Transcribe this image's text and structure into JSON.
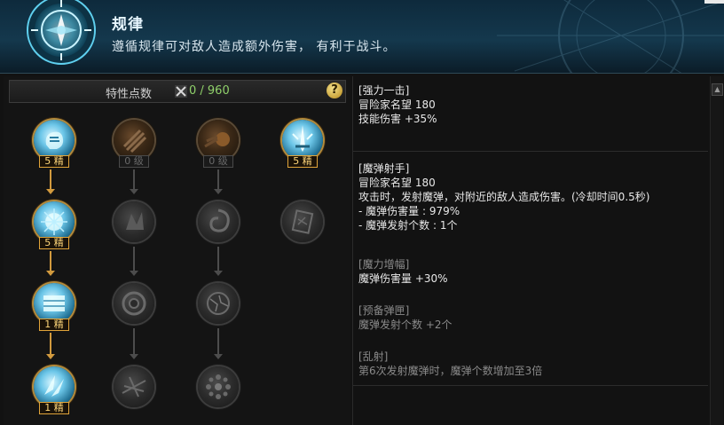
{
  "header": {
    "title": "规律",
    "description": "遵循规律可对敌人造成额外伤害， 有利于战斗。",
    "emblem_icon": "compass-emblem-icon"
  },
  "points": {
    "label": "特性点数",
    "value": "0 / 960",
    "icon": "crossed-swords-icon",
    "help_glyph": "?"
  },
  "skills": [
    {
      "id": "s1",
      "level": "5 精",
      "state": "active",
      "icon": "ice-fist-icon"
    },
    {
      "id": "s2",
      "level": "0 级",
      "state": "dormant",
      "icon": "dark-claw-icon"
    },
    {
      "id": "s3",
      "level": "0 级",
      "state": "dormant",
      "icon": "fire-comet-icon"
    },
    {
      "id": "s4",
      "level": "5 精",
      "state": "active",
      "icon": "ice-sword-icon"
    },
    {
      "id": "s5",
      "level": "5 精",
      "state": "active",
      "icon": "frost-burst-icon"
    },
    {
      "id": "s6",
      "level": "",
      "state": "locked",
      "icon": "shadow-beast-icon"
    },
    {
      "id": "s7",
      "level": "",
      "state": "locked",
      "icon": "vortex-icon"
    },
    {
      "id": "s8",
      "level": "",
      "state": "locked",
      "icon": "rune-tablet-icon"
    },
    {
      "id": "s9",
      "level": "1 精",
      "state": "active",
      "icon": "ice-block-icon"
    },
    {
      "id": "s10",
      "level": "",
      "state": "locked",
      "icon": "whirlwind-icon"
    },
    {
      "id": "s11",
      "level": "",
      "state": "locked",
      "icon": "cracked-orb-icon"
    },
    {
      "id": "s12",
      "level": "1 精",
      "state": "active",
      "icon": "ice-shards-icon"
    },
    {
      "id": "s13",
      "level": "",
      "state": "locked",
      "icon": "blade-slash-icon"
    },
    {
      "id": "s14",
      "level": "",
      "state": "locked",
      "icon": "orb-ring-icon"
    }
  ],
  "details": {
    "strong_strike": {
      "name": "[强力一击]",
      "fame_label": "冒险家名望",
      "fame_value": "180",
      "effect_label": "技能伤害",
      "effect_value": "+35%"
    },
    "magic_shooter": {
      "name": "[魔弹射手]",
      "fame_label": "冒险家名望",
      "fame_value": "180",
      "description": "攻击时，发射魔弹，对附近的敌人造成伤害。(冷却时间0.5秒)",
      "stat1_label": "- 魔弹伤害量",
      "stat1_value": ": 979%",
      "stat2_label": "- 魔弹发射个数",
      "stat2_value": ": 1个"
    },
    "magic_amplify": {
      "name": "[魔力增幅]",
      "effect_label": "魔弹伤害量",
      "effect_value": "+30%"
    },
    "reserve_mag": {
      "name": "[预备弹匣]",
      "effect_label": "魔弹发射个数",
      "effect_value": "+2个"
    },
    "barrage": {
      "name": "[乱射]",
      "effect_text": "第6次发射魔弹时，魔弹个数增加至3倍"
    }
  },
  "colors": {
    "active_gold": "#d29a3e",
    "locked_gray": "#4c4c4c",
    "points_green": "#8fd06a"
  }
}
